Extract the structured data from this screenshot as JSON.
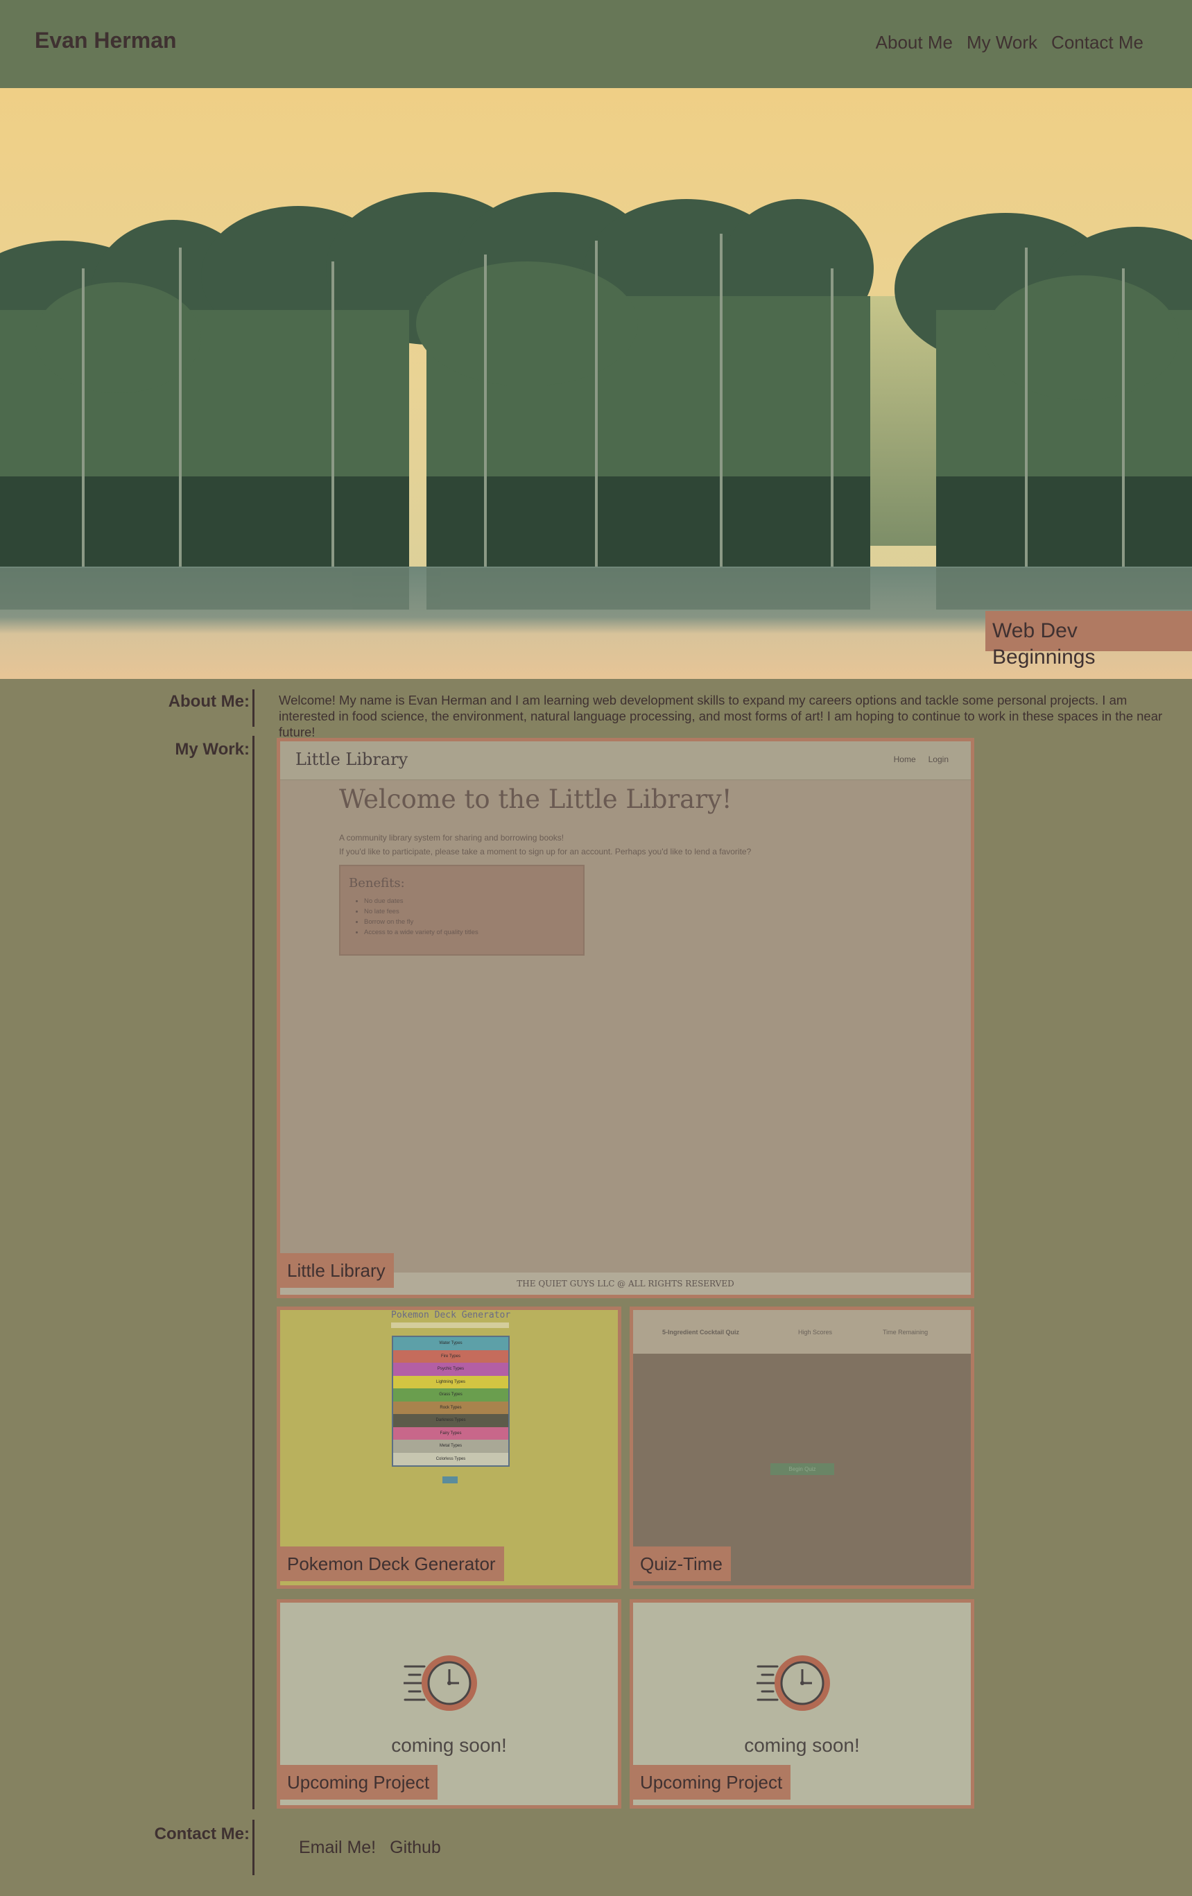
{
  "header": {
    "title": "Evan Herman",
    "nav": [
      "About Me",
      "My Work",
      "Contact Me"
    ]
  },
  "hero": {
    "badge": "Web Dev Beginnings",
    "image_icon": "jungle-landscape-image"
  },
  "about": {
    "label": "About Me:",
    "text": "Welcome! My name is Evan Herman and I am learning web development skills to expand my careers options and tackle some personal projects. I am interested in food science, the environment, natural language processing, and most forms of art! I am hoping to continue to work in these spaces in the near future!"
  },
  "work": {
    "label": "My Work:",
    "projects": [
      {
        "name": "Little Library",
        "preview": {
          "brand": "Little Library",
          "nav": [
            "Home",
            "Login"
          ],
          "heading": "Welcome to the Little Library!",
          "intro1": "A community library system for sharing and borrowing books!",
          "intro2": "If you'd like to participate, please take a moment to sign up for an account. Perhaps you'd like to lend a favorite?",
          "benefits_title": "Benefits:",
          "benefits": [
            "No due dates",
            "No late fees",
            "Borrow on the fly",
            "Access to a wide variety of quality titles"
          ],
          "footer": "THE QUIET GUYS LLC @ ALL RIGHTS RESERVED"
        }
      },
      {
        "name": "Pokemon Deck Generator",
        "preview": {
          "title": "Pokemon Deck Generator",
          "types": [
            "Water Types",
            "Fire Types",
            "Psychic Types",
            "Lightning Types",
            "Grass Types",
            "Rock Types",
            "Darkness Types",
            "Fairy Types",
            "Metal Types",
            "Colorless Types"
          ],
          "type_colors": [
            "#5da0a8",
            "#c56c5c",
            "#b35fa5",
            "#d3c542",
            "#6a9e4e",
            "#a9834d",
            "#5d5b4a",
            "#c8678a",
            "#a9a896",
            "#c7c6b0"
          ]
        }
      },
      {
        "name": "Quiz-Time",
        "preview": {
          "title": "5-Ingredient Cocktail Quiz",
          "link1": "High Scores",
          "link2": "Time Remaining",
          "button": "Begin Quiz"
        }
      },
      {
        "name": "Upcoming Project",
        "preview": {
          "text": "coming soon!",
          "icon": "stopwatch-icon"
        }
      },
      {
        "name": "Upcoming Project",
        "preview": {
          "text": "coming soon!",
          "icon": "stopwatch-icon"
        }
      }
    ]
  },
  "contact": {
    "label": "Contact Me:",
    "links": [
      "Email Me!",
      "Github"
    ]
  }
}
